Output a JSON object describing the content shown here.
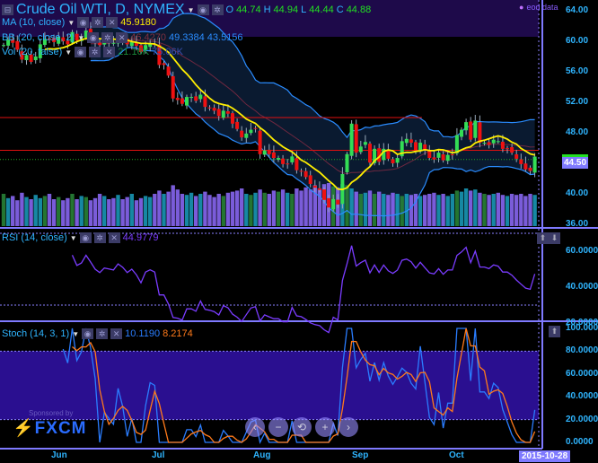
{
  "header": {
    "title": "Crude Oil WTI, D, NYMEX",
    "o_label": "O",
    "o": "44.74",
    "h_label": "H",
    "h": "44.94",
    "l_label": "L",
    "l": "44.44",
    "c_label": "C",
    "c": "44.88",
    "eod": "eod data"
  },
  "indicators": {
    "ma": {
      "label": "MA (10, close)",
      "value": "45.9180"
    },
    "bb": {
      "label": "BB (20, close, 2)",
      "v1": "46.4270",
      "v2": "49.3384",
      "v3": "43.5156"
    },
    "vol": {
      "label": "Vol (20, false)",
      "v1": "21.16K",
      "v2": "75.06K"
    },
    "rsi": {
      "label": "RSI (14, close)",
      "value": "44.9779"
    },
    "stoch": {
      "label": "Stoch (14, 3, 1)",
      "k": "10.1190",
      "d": "8.2174"
    }
  },
  "price_axis": [
    "64.00",
    "60.00",
    "56.00",
    "52.00",
    "48.00",
    "40.00",
    "36.00"
  ],
  "price_axis_values": [
    64,
    60,
    56,
    52,
    48,
    40,
    36
  ],
  "last_price": "44.50",
  "rsi_axis": [
    "60.0000",
    "40.0000",
    "20.0000"
  ],
  "stoch_axis": [
    "100.0000",
    "80.0000",
    "60.0000",
    "40.0000",
    "20.0000",
    "0.0000"
  ],
  "months": [
    "Jun",
    "Jul",
    "Aug",
    "Sep",
    "Oct"
  ],
  "cursor_date": "2015-10-28",
  "sponsor": {
    "text": "Sponsored by",
    "brand": "FXCM"
  },
  "nav": [
    "‹",
    "−",
    "⟲",
    "+",
    "›"
  ],
  "colors": {
    "up": "#33dd55",
    "down": "#ee1111",
    "ma": "#ffee00",
    "bb": "#2a8cff",
    "rsi": "#7a3cff",
    "stochK": "#2a7dff",
    "stochD": "#ff7a1a",
    "vol": "#8f6cff"
  },
  "chart_data": {
    "type": "candlestick",
    "closes": [
      59.5,
      60.2,
      59.8,
      58.9,
      57.6,
      58.2,
      57.3,
      58.0,
      59.6,
      60.3,
      60.2,
      59.9,
      60.6,
      60.0,
      59.6,
      61.2,
      60.1,
      60.4,
      61.4,
      60.7,
      59.9,
      59.5,
      60.0,
      59.9,
      59.8,
      60.4,
      60.1,
      59.6,
      59.9,
      59.4,
      58.6,
      59.5,
      59.7,
      59.5,
      56.9,
      56.9,
      55.5,
      52.5,
      52.3,
      51.8,
      52.7,
      52.7,
      52.2,
      53.0,
      51.4,
      51.2,
      50.9,
      50.2,
      50.9,
      50.5,
      49.2,
      48.5,
      47.4,
      47.9,
      48.4,
      48.5,
      45.2,
      45.7,
      45.2,
      44.7,
      44.7,
      43.9,
      43.9,
      44.9,
      43.1,
      42.9,
      42.2,
      41.3,
      40.8,
      40.5,
      39.2,
      38.2,
      39.3,
      38.6,
      42.6,
      45.2,
      49.2,
      45.4,
      46.2,
      46.8,
      44.1,
      45.9,
      44.2,
      45.9,
      44.6,
      44.0,
      44.7,
      46.9,
      47.2,
      46.7,
      45.5,
      46.7,
      45.7,
      44.7,
      44.5,
      45.4,
      44.4,
      45.1,
      45.1,
      47.7,
      48.4,
      49.4,
      47.1,
      49.6,
      46.7,
      46.7,
      46.4,
      47.1,
      46.9,
      45.9,
      45.9,
      45.4,
      44.6,
      43.9,
      43.2,
      43.0,
      44.88
    ],
    "volumes_k": [
      300,
      260,
      280,
      240,
      310,
      270,
      250,
      290,
      260,
      280,
      300,
      250,
      270,
      240,
      260,
      300,
      250,
      280,
      270,
      240,
      260,
      300,
      280,
      250,
      260,
      290,
      250,
      270,
      300,
      240,
      260,
      280,
      270,
      300,
      330,
      300,
      320,
      380,
      340,
      300,
      290,
      310,
      280,
      300,
      320,
      290,
      270,
      300,
      280,
      310,
      320,
      330,
      350,
      300,
      290,
      310,
      340,
      310,
      300,
      330,
      320,
      340,
      310,
      300,
      350,
      330,
      360,
      340,
      380,
      350,
      390,
      400,
      370,
      360,
      390,
      380,
      350,
      320,
      300,
      310,
      330,
      300,
      320,
      300,
      290,
      310,
      300,
      280,
      300,
      290,
      300,
      280,
      290,
      300,
      310,
      290,
      300,
      280,
      300,
      330,
      320,
      350,
      330,
      340,
      310,
      300,
      290,
      300,
      310,
      290,
      280,
      300,
      290,
      300,
      280,
      300,
      290
    ],
    "support_lines": [
      50.0,
      45.7
    ],
    "ylim": [
      36,
      64
    ]
  }
}
